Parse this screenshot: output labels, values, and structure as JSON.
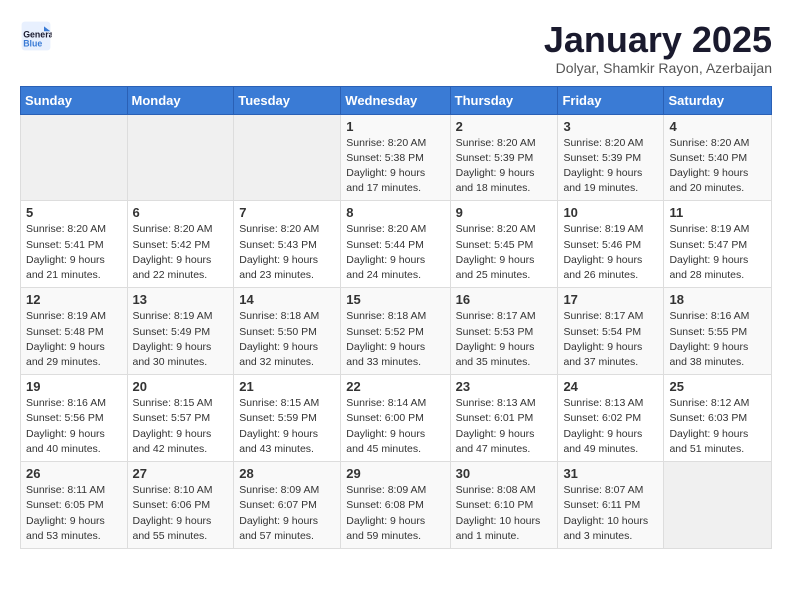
{
  "logo": {
    "general": "General",
    "blue": "Blue"
  },
  "header": {
    "title": "January 2025",
    "subtitle": "Dolyar, Shamkir Rayon, Azerbaijan"
  },
  "days_of_week": [
    "Sunday",
    "Monday",
    "Tuesday",
    "Wednesday",
    "Thursday",
    "Friday",
    "Saturday"
  ],
  "weeks": [
    [
      {
        "day": "",
        "info": ""
      },
      {
        "day": "",
        "info": ""
      },
      {
        "day": "",
        "info": ""
      },
      {
        "day": "1",
        "info": "Sunrise: 8:20 AM\nSunset: 5:38 PM\nDaylight: 9 hours\nand 17 minutes."
      },
      {
        "day": "2",
        "info": "Sunrise: 8:20 AM\nSunset: 5:39 PM\nDaylight: 9 hours\nand 18 minutes."
      },
      {
        "day": "3",
        "info": "Sunrise: 8:20 AM\nSunset: 5:39 PM\nDaylight: 9 hours\nand 19 minutes."
      },
      {
        "day": "4",
        "info": "Sunrise: 8:20 AM\nSunset: 5:40 PM\nDaylight: 9 hours\nand 20 minutes."
      }
    ],
    [
      {
        "day": "5",
        "info": "Sunrise: 8:20 AM\nSunset: 5:41 PM\nDaylight: 9 hours\nand 21 minutes."
      },
      {
        "day": "6",
        "info": "Sunrise: 8:20 AM\nSunset: 5:42 PM\nDaylight: 9 hours\nand 22 minutes."
      },
      {
        "day": "7",
        "info": "Sunrise: 8:20 AM\nSunset: 5:43 PM\nDaylight: 9 hours\nand 23 minutes."
      },
      {
        "day": "8",
        "info": "Sunrise: 8:20 AM\nSunset: 5:44 PM\nDaylight: 9 hours\nand 24 minutes."
      },
      {
        "day": "9",
        "info": "Sunrise: 8:20 AM\nSunset: 5:45 PM\nDaylight: 9 hours\nand 25 minutes."
      },
      {
        "day": "10",
        "info": "Sunrise: 8:19 AM\nSunset: 5:46 PM\nDaylight: 9 hours\nand 26 minutes."
      },
      {
        "day": "11",
        "info": "Sunrise: 8:19 AM\nSunset: 5:47 PM\nDaylight: 9 hours\nand 28 minutes."
      }
    ],
    [
      {
        "day": "12",
        "info": "Sunrise: 8:19 AM\nSunset: 5:48 PM\nDaylight: 9 hours\nand 29 minutes."
      },
      {
        "day": "13",
        "info": "Sunrise: 8:19 AM\nSunset: 5:49 PM\nDaylight: 9 hours\nand 30 minutes."
      },
      {
        "day": "14",
        "info": "Sunrise: 8:18 AM\nSunset: 5:50 PM\nDaylight: 9 hours\nand 32 minutes."
      },
      {
        "day": "15",
        "info": "Sunrise: 8:18 AM\nSunset: 5:52 PM\nDaylight: 9 hours\nand 33 minutes."
      },
      {
        "day": "16",
        "info": "Sunrise: 8:17 AM\nSunset: 5:53 PM\nDaylight: 9 hours\nand 35 minutes."
      },
      {
        "day": "17",
        "info": "Sunrise: 8:17 AM\nSunset: 5:54 PM\nDaylight: 9 hours\nand 37 minutes."
      },
      {
        "day": "18",
        "info": "Sunrise: 8:16 AM\nSunset: 5:55 PM\nDaylight: 9 hours\nand 38 minutes."
      }
    ],
    [
      {
        "day": "19",
        "info": "Sunrise: 8:16 AM\nSunset: 5:56 PM\nDaylight: 9 hours\nand 40 minutes."
      },
      {
        "day": "20",
        "info": "Sunrise: 8:15 AM\nSunset: 5:57 PM\nDaylight: 9 hours\nand 42 minutes."
      },
      {
        "day": "21",
        "info": "Sunrise: 8:15 AM\nSunset: 5:59 PM\nDaylight: 9 hours\nand 43 minutes."
      },
      {
        "day": "22",
        "info": "Sunrise: 8:14 AM\nSunset: 6:00 PM\nDaylight: 9 hours\nand 45 minutes."
      },
      {
        "day": "23",
        "info": "Sunrise: 8:13 AM\nSunset: 6:01 PM\nDaylight: 9 hours\nand 47 minutes."
      },
      {
        "day": "24",
        "info": "Sunrise: 8:13 AM\nSunset: 6:02 PM\nDaylight: 9 hours\nand 49 minutes."
      },
      {
        "day": "25",
        "info": "Sunrise: 8:12 AM\nSunset: 6:03 PM\nDaylight: 9 hours\nand 51 minutes."
      }
    ],
    [
      {
        "day": "26",
        "info": "Sunrise: 8:11 AM\nSunset: 6:05 PM\nDaylight: 9 hours\nand 53 minutes."
      },
      {
        "day": "27",
        "info": "Sunrise: 8:10 AM\nSunset: 6:06 PM\nDaylight: 9 hours\nand 55 minutes."
      },
      {
        "day": "28",
        "info": "Sunrise: 8:09 AM\nSunset: 6:07 PM\nDaylight: 9 hours\nand 57 minutes."
      },
      {
        "day": "29",
        "info": "Sunrise: 8:09 AM\nSunset: 6:08 PM\nDaylight: 9 hours\nand 59 minutes."
      },
      {
        "day": "30",
        "info": "Sunrise: 8:08 AM\nSunset: 6:10 PM\nDaylight: 10 hours\nand 1 minute."
      },
      {
        "day": "31",
        "info": "Sunrise: 8:07 AM\nSunset: 6:11 PM\nDaylight: 10 hours\nand 3 minutes."
      },
      {
        "day": "",
        "info": ""
      }
    ]
  ]
}
